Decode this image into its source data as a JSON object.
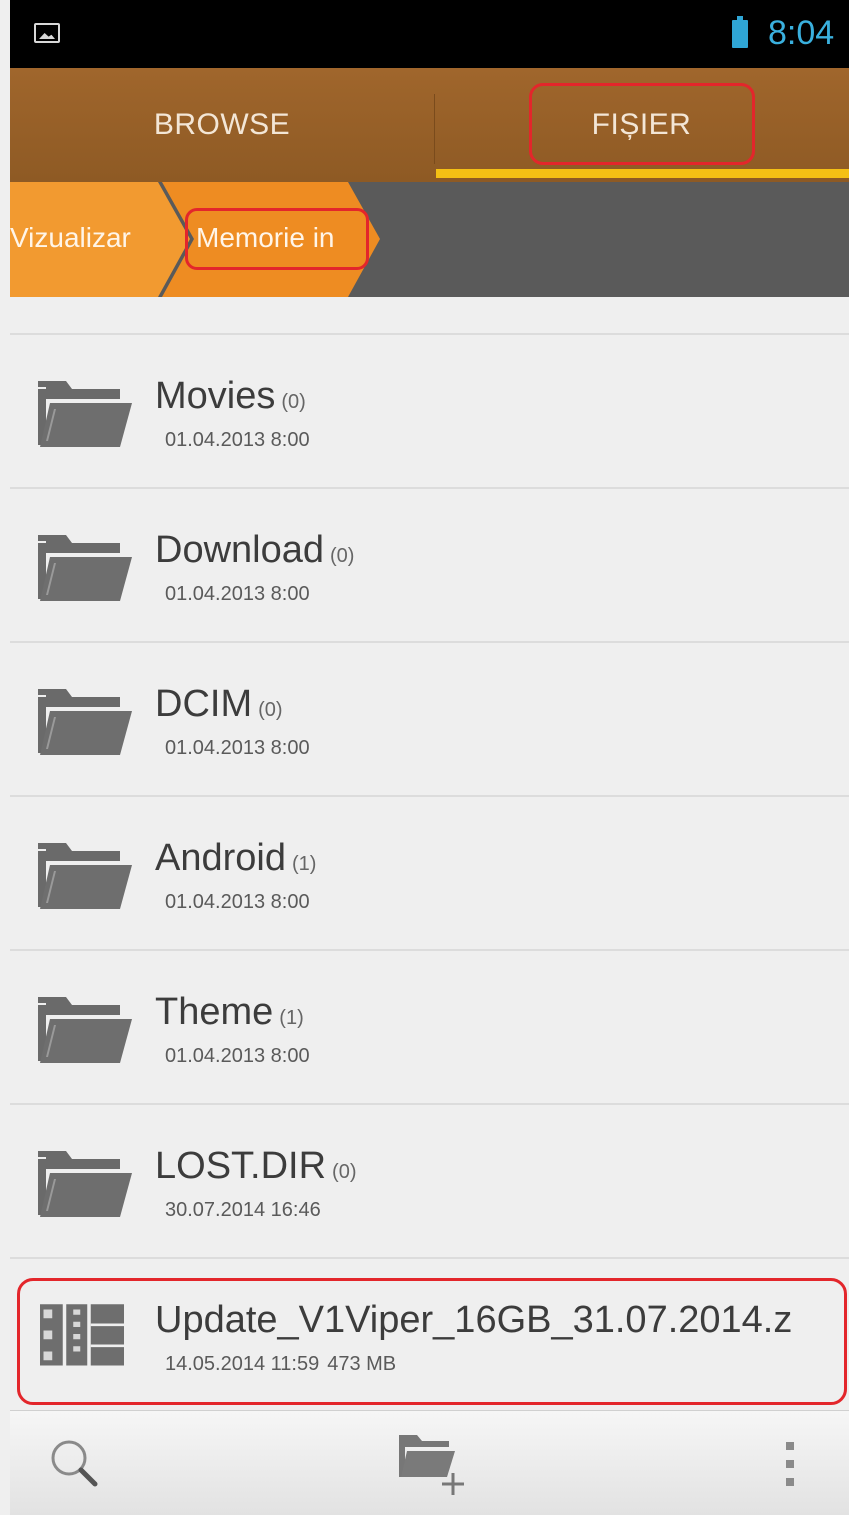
{
  "status_bar": {
    "time": "8:04"
  },
  "tabs": [
    {
      "label": "BROWSE",
      "selected": false
    },
    {
      "label": "FIȘIER",
      "selected": true
    }
  ],
  "breadcrumb": [
    {
      "label": "Vizualizar"
    },
    {
      "label": "Memorie in"
    }
  ],
  "files": [
    {
      "name": "Movies",
      "count": "(0)",
      "date": "01.04.2013 8:00",
      "icon": "folder-icon"
    },
    {
      "name": "Download",
      "count": "(0)",
      "date": "01.04.2013 8:00",
      "icon": "folder-icon"
    },
    {
      "name": "DCIM",
      "count": "(0)",
      "date": "01.04.2013 8:00",
      "icon": "folder-icon"
    },
    {
      "name": "Android",
      "count": "(1)",
      "date": "01.04.2013 8:00",
      "icon": "folder-icon"
    },
    {
      "name": "Theme",
      "count": "(1)",
      "date": "01.04.2013 8:00",
      "icon": "folder-icon"
    },
    {
      "name": "LOST.DIR",
      "count": "(0)",
      "date": "30.07.2014 16:46",
      "icon": "folder-icon"
    },
    {
      "name": "Update_V1Viper_16GB_31.07.2014.z",
      "date": "14.05.2014 11:59",
      "size": "473 MB",
      "icon": "archive-icon"
    }
  ],
  "toolbar": {
    "icons": [
      "search-icon",
      "new-folder-icon",
      "overflow-menu-icon"
    ]
  },
  "colors": {
    "tab_bar": "#9a622a",
    "breadcrumb": "#f0942a",
    "tab_indicator": "#f5c014",
    "highlight": "#e3262b",
    "status_accent": "#3ab0de"
  }
}
